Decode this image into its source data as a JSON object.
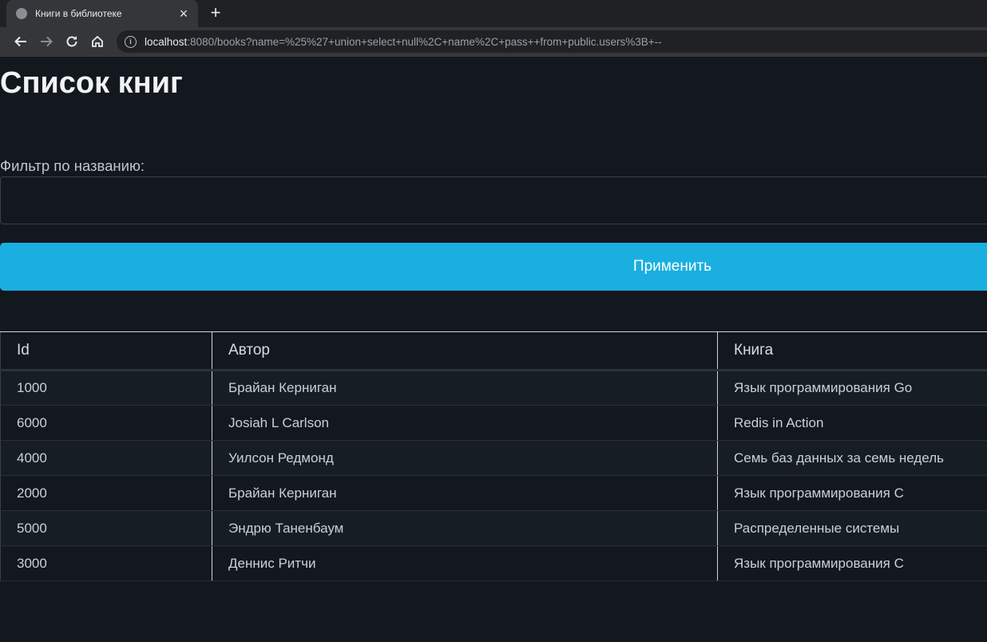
{
  "browser": {
    "tab_title": "Книги в библиотеке",
    "url_host": "localhost",
    "url_rest": ":8080/books?name=%25%27+union+select+null%2C+name%2C+pass++from+public.users%3B+--"
  },
  "page": {
    "title": "Список книг",
    "filter_label": "Фильтр по названию:",
    "filter_value": "",
    "apply_label": "Применить"
  },
  "table": {
    "headers": [
      "Id",
      "Автор",
      "Книга"
    ],
    "rows": [
      [
        "1000",
        "Брайан Керниган",
        "Язык программирования Go"
      ],
      [
        "6000",
        "Josiah L Carlson",
        "Redis in Action"
      ],
      [
        "4000",
        "Уилсон Редмонд",
        "Семь баз данных за семь недель"
      ],
      [
        "2000",
        "Брайан Керниган",
        "Язык программирования С"
      ],
      [
        "5000",
        "Эндрю Таненбаум",
        "Распределенные системы"
      ],
      [
        "3000",
        "Деннис Ритчи",
        "Язык программирования С"
      ]
    ]
  },
  "colors": {
    "accent": "#1aafe0",
    "background": "#13181f"
  }
}
